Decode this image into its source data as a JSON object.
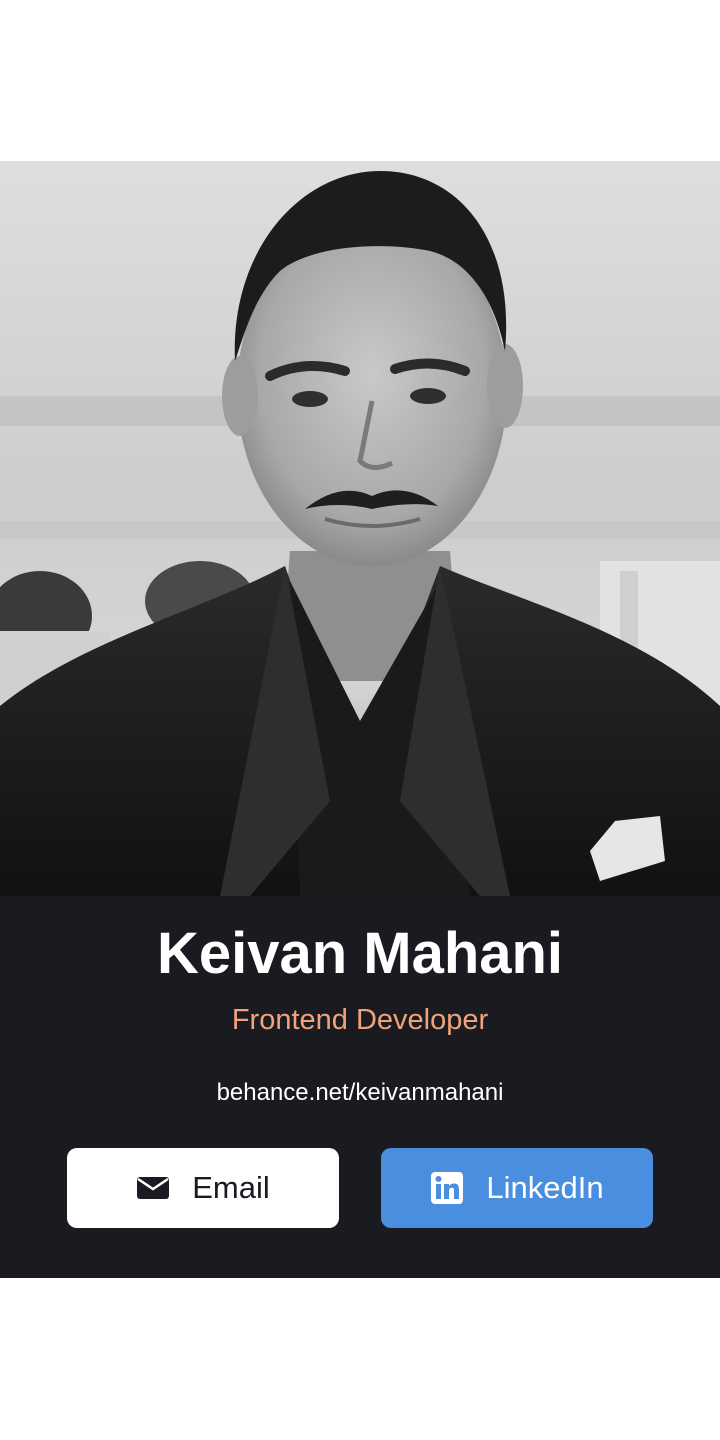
{
  "profile": {
    "name": "Keivan Mahani",
    "role": "Frontend Developer",
    "portfolio_link": "behance.net/keivanmahani",
    "photo_icon": "profile-photo"
  },
  "actions": {
    "email_label": "Email",
    "email_icon": "envelope-icon",
    "linkedin_label": "LinkedIn",
    "linkedin_icon": "linkedin-icon"
  },
  "colors": {
    "card_background": "#1a1b21",
    "role_accent": "#f0a27a",
    "linkedin_blue": "#4a8fdf",
    "email_button_bg": "#ffffff"
  }
}
